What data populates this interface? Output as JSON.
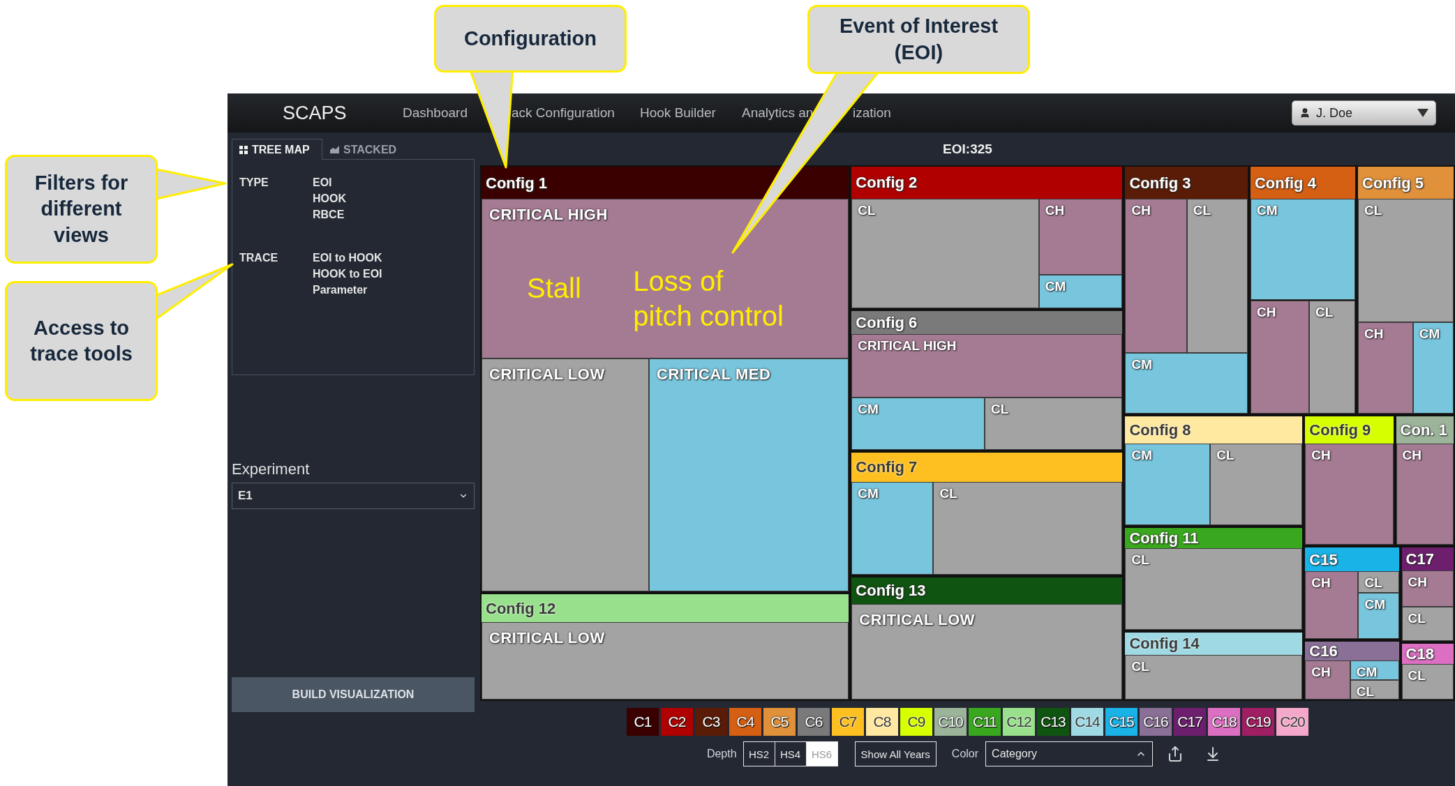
{
  "callouts": [
    {
      "lines": [
        "Configuration"
      ]
    },
    {
      "lines": [
        "Event of Interest",
        "(EOI)"
      ]
    },
    {
      "lines": [
        "Filters for",
        "different",
        "views"
      ]
    },
    {
      "lines": [
        "Access to",
        "trace tools"
      ]
    }
  ],
  "nav": {
    "brand": "SCAPS",
    "links": [
      "Dashboard",
      "ack Configuration",
      "Hook Builder",
      "Analytics an",
      "ization"
    ],
    "user": "J. Doe"
  },
  "view_tabs": [
    {
      "label": "TREE MAP",
      "selected": true
    },
    {
      "label": "STACKED",
      "selected": false
    }
  ],
  "filters": [
    {
      "label": "TYPE",
      "options": [
        "EOI",
        "HOOK",
        "RBCE"
      ]
    },
    {
      "label": "TRACE",
      "options": [
        "EOI to HOOK",
        "HOOK to EOI",
        "Parameter"
      ]
    }
  ],
  "experiment": {
    "label": "Experiment",
    "value": "E1"
  },
  "build_button": "BUILD VISUALIZATION",
  "treemap": {
    "title": "EOI:325",
    "configs": [
      {
        "label": "Config 1",
        "color": "#3a0000",
        "cells": [
          {
            "label": "CRITICAL HIGH",
            "kind": "high"
          },
          {
            "label": "CRITICAL LOW",
            "kind": "low"
          },
          {
            "label": "CRITICAL MED",
            "kind": "med"
          }
        ]
      },
      {
        "label": "Config 2",
        "color": "#b00000",
        "cells": [
          {
            "label": "CL",
            "kind": "low"
          },
          {
            "label": "CH",
            "kind": "high"
          },
          {
            "label": "CM",
            "kind": "med"
          }
        ]
      },
      {
        "label": "Config 3",
        "color": "#5a1c06",
        "cells": [
          {
            "label": "CH",
            "kind": "high"
          },
          {
            "label": "CL",
            "kind": "low"
          },
          {
            "label": "CM",
            "kind": "med"
          }
        ]
      },
      {
        "label": "Config 4",
        "color": "#d55f12",
        "cells": [
          {
            "label": "CM",
            "kind": "med"
          },
          {
            "label": "CH",
            "kind": "high"
          },
          {
            "label": "CL",
            "kind": "low"
          }
        ]
      },
      {
        "label": "Config 5",
        "color": "#e0913a",
        "cells": [
          {
            "label": "CL",
            "kind": "low"
          },
          {
            "label": "CH",
            "kind": "high"
          },
          {
            "label": "CM",
            "kind": "med"
          }
        ]
      },
      {
        "label": "Config 6",
        "color": "#7a7a7a",
        "cells": [
          {
            "label": "CRITICAL HIGH",
            "kind": "high"
          },
          {
            "label": "CM",
            "kind": "med"
          },
          {
            "label": "CL",
            "kind": "low"
          }
        ]
      },
      {
        "label": "Config 7",
        "color": "#fdc020",
        "cells": [
          {
            "label": "CM",
            "kind": "med"
          },
          {
            "label": "CL",
            "kind": "low"
          }
        ]
      },
      {
        "label": "Config 8",
        "color": "#ffe8a0",
        "cells": [
          {
            "label": "CM",
            "kind": "med"
          },
          {
            "label": "CL",
            "kind": "low"
          }
        ]
      },
      {
        "label": "Config 9",
        "color": "#d6ff00",
        "cells": [
          {
            "label": "CH",
            "kind": "high"
          }
        ]
      },
      {
        "label": "Con. 1",
        "color": "#9cb49a",
        "cells": [
          {
            "label": "CH",
            "kind": "high"
          }
        ]
      },
      {
        "label": "Config 11",
        "color": "#3aa81e",
        "cells": [
          {
            "label": "CL",
            "kind": "low"
          }
        ]
      },
      {
        "label": "Config 12",
        "color": "#98e08c",
        "cells": [
          {
            "label": "CRITICAL LOW",
            "kind": "low"
          }
        ]
      },
      {
        "label": "Config 13",
        "color": "#0f5410",
        "cells": [
          {
            "label": "CRITICAL LOW",
            "kind": "low"
          }
        ]
      },
      {
        "label": "Config 14",
        "color": "#9fd9e3",
        "cells": [
          {
            "label": "CL",
            "kind": "low"
          }
        ]
      },
      {
        "label": "C15",
        "color": "#19b3e8",
        "cells": [
          {
            "label": "CH",
            "kind": "high"
          },
          {
            "label": "CL",
            "kind": "low"
          },
          {
            "label": "CM",
            "kind": "med"
          }
        ]
      },
      {
        "label": "C16",
        "color": "#8a6f96",
        "cells": [
          {
            "label": "CH",
            "kind": "high"
          },
          {
            "label": "CM",
            "kind": "med"
          },
          {
            "label": "CL",
            "kind": "low"
          }
        ]
      },
      {
        "label": "C17",
        "color": "#6d1f6e",
        "cells": [
          {
            "label": "CH",
            "kind": "high"
          },
          {
            "label": "CL",
            "kind": "low"
          }
        ]
      },
      {
        "label": "C18",
        "color": "#dd6fc3",
        "cells": [
          {
            "label": "CL",
            "kind": "low"
          }
        ]
      }
    ],
    "annotations": [
      {
        "lines": [
          "Stall"
        ]
      },
      {
        "lines": [
          "Loss of",
          "pitch control"
        ]
      }
    ]
  },
  "legend": [
    {
      "label": "C1",
      "color": "#3a0000"
    },
    {
      "label": "C2",
      "color": "#b00000"
    },
    {
      "label": "C3",
      "color": "#5a1c06"
    },
    {
      "label": "C4",
      "color": "#d55f12"
    },
    {
      "label": "C5",
      "color": "#e0913a"
    },
    {
      "label": "C6",
      "color": "#7a7a7a"
    },
    {
      "label": "C7",
      "color": "#fdc020"
    },
    {
      "label": "C8",
      "color": "#ffe8a0"
    },
    {
      "label": "C9",
      "color": "#d6ff00"
    },
    {
      "label": "C10",
      "color": "#9cb49a"
    },
    {
      "label": "C11",
      "color": "#3aa81e"
    },
    {
      "label": "C12",
      "color": "#98e08c"
    },
    {
      "label": "C13",
      "color": "#0f5410"
    },
    {
      "label": "C14",
      "color": "#9fd9e3"
    },
    {
      "label": "C15",
      "color": "#19b3e8"
    },
    {
      "label": "C16",
      "color": "#8a6f96"
    },
    {
      "label": "C17",
      "color": "#6d1f6e"
    },
    {
      "label": "C18",
      "color": "#dd6fc3"
    },
    {
      "label": "C19",
      "color": "#a01e63"
    },
    {
      "label": "C20",
      "color": "#f5a7c9"
    }
  ],
  "controls": {
    "depth_label": "Depth",
    "depth_options": [
      {
        "label": "HS2",
        "selected": false
      },
      {
        "label": "HS4",
        "selected": false
      },
      {
        "label": "HS6",
        "selected": true
      }
    ],
    "years_button": "Show All Years",
    "color_label": "Color",
    "color_select": "Category"
  }
}
